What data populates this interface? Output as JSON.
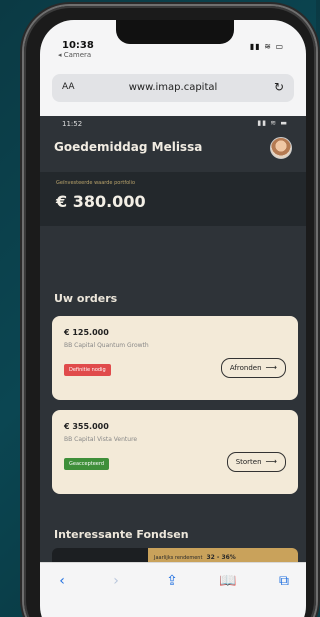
{
  "phone_status": {
    "time": "10:38",
    "back_app": "◂ Camera",
    "icons": "▮▮ ≋ ▭"
  },
  "address_bar": {
    "aa": "AA",
    "url": "www.imap.capital",
    "reload": "↻"
  },
  "app_status": {
    "time": "11:52",
    "icons": "▮▮ ≋ ▬"
  },
  "header": {
    "greeting": "Goedemiddag Melissa"
  },
  "portfolio": {
    "label": "Geïnvesteerde waarde portfolio",
    "value": "€ 380.000"
  },
  "orders_section": {
    "title": "Uw orders",
    "orders": [
      {
        "amount": "€ 125.000",
        "fund": "BB Capital Quantum Growth",
        "badge": "Definitie nodig",
        "badge_color": "#e04b4b",
        "action": "Afronden"
      },
      {
        "amount": "€ 355.000",
        "fund": "BB Capital Vista Venture",
        "badge": "Geaccepteerd",
        "badge_color": "#3f8f3a",
        "action": "Storten"
      }
    ]
  },
  "funds_section": {
    "title": "Interessante Fondsen",
    "yield_label": "Jaarlijks rendement",
    "yield_value": "32 - 36%"
  },
  "toolbar": {
    "back_icon": "‹",
    "forward_icon": "›",
    "share_icon": "⇪",
    "bookmarks_icon": "📖",
    "tabs_icon": "⧉"
  },
  "colors": {
    "background": "#0b4652",
    "app_bg": "#2e3338",
    "card_bg": "#f3ead8",
    "accent_gold": "#c9a25b",
    "safari_blue": "#1f6fe0"
  }
}
